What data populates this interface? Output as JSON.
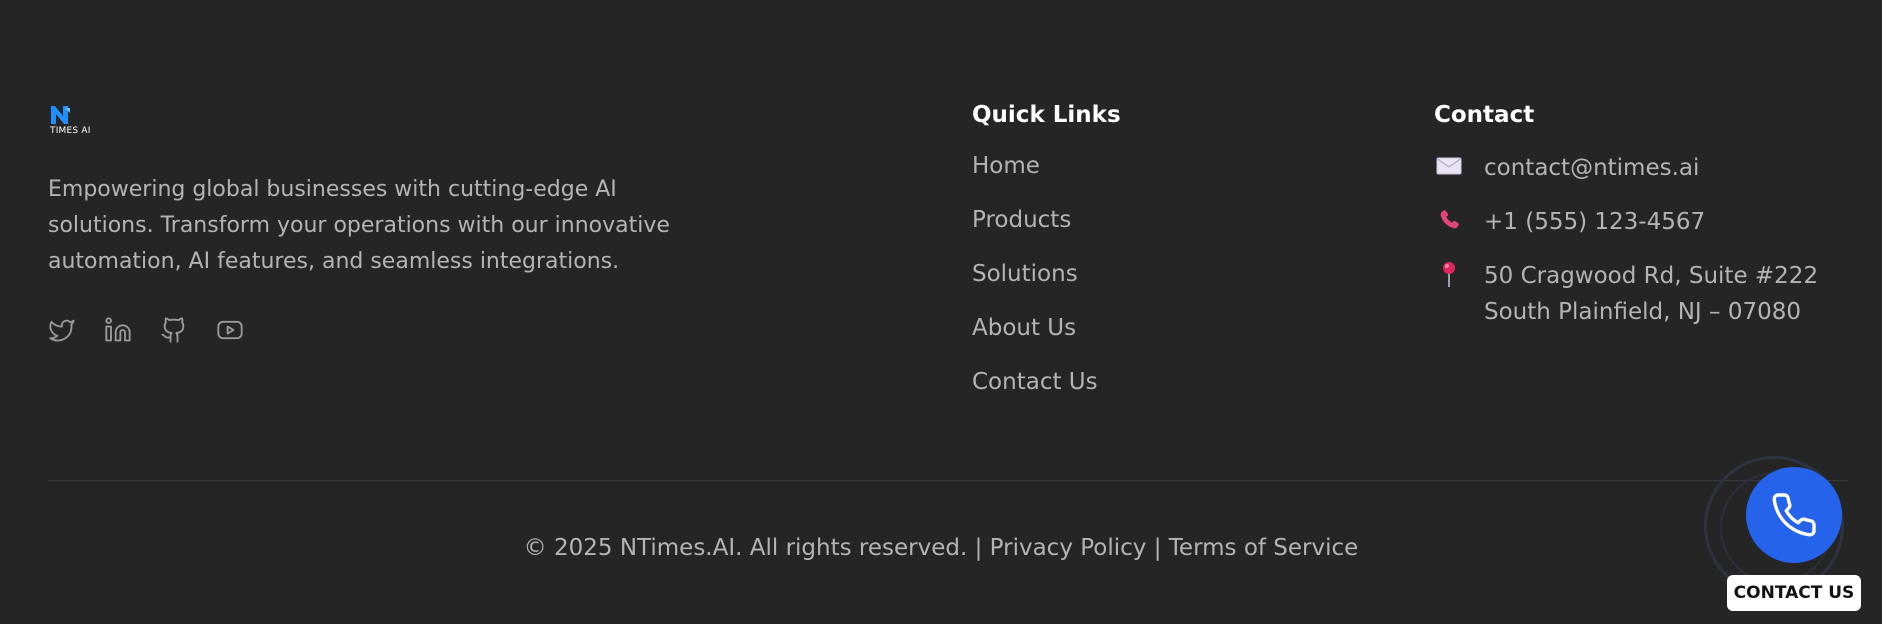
{
  "brand": {
    "logo_text": "TIMES AI",
    "tagline": "Empowering global businesses with cutting-edge AI solutions. Transform your operations with our innovative automation, AI features, and seamless integrations.",
    "socials": [
      "twitter-icon",
      "linkedin-icon",
      "github-icon",
      "youtube-icon"
    ]
  },
  "quick_links": {
    "title": "Quick Links",
    "items": [
      "Home",
      "Products",
      "Solutions",
      "About Us",
      "Contact Us"
    ]
  },
  "contact": {
    "title": "Contact",
    "email": "contact@ntimes.ai",
    "phone": "+1 (555) 123-4567",
    "address_line1": "50 Cragwood Rd, Suite #222",
    "address_line2": "South Plainfield, NJ – 07080"
  },
  "bottom": {
    "copyright": "© 2025 NTimes.AI. All rights reserved.",
    "separator": " | ",
    "privacy": "Privacy Policy",
    "terms": "Terms of Service"
  },
  "fab": {
    "label": "CONTACT US",
    "icon": "phone-icon"
  },
  "colors": {
    "background": "#252525",
    "heading": "#ffffff",
    "text": "#b4b4b4",
    "accent_blue": "#2563eb",
    "phone_pink": "#e0457b",
    "logo_blue": "#1e90ff"
  }
}
